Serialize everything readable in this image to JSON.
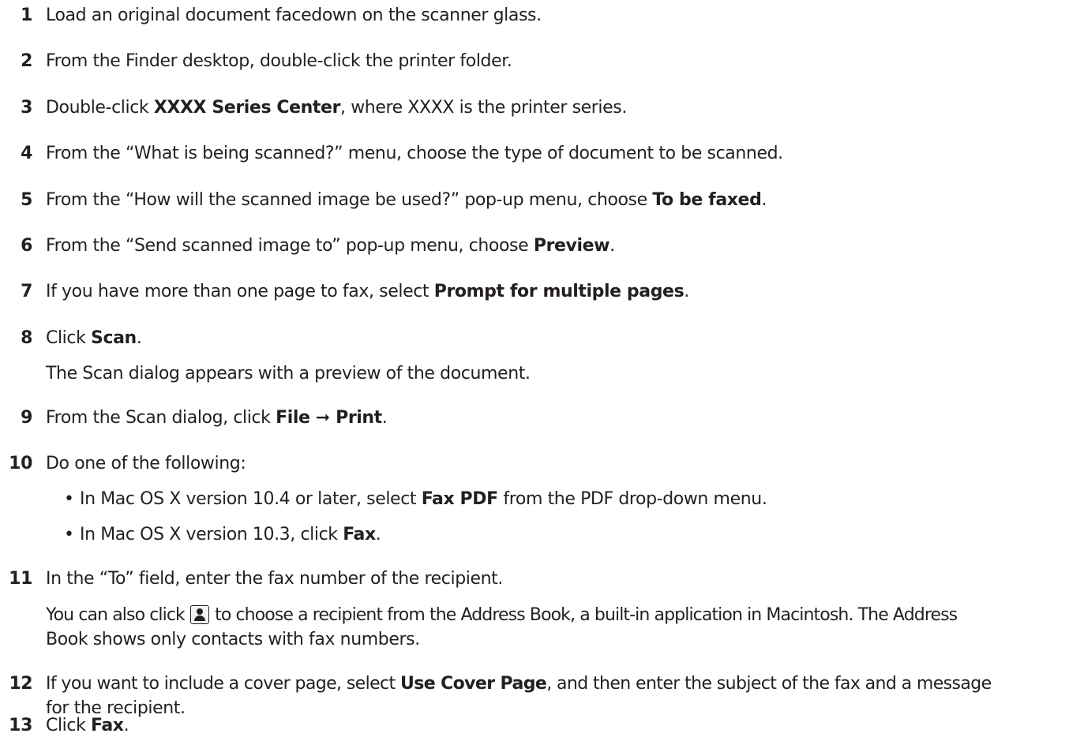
{
  "steps": [
    {
      "num": "1",
      "text": "Load an original document facedown on the scanner glass."
    },
    {
      "num": "2",
      "text": "From the Finder desktop, double-click the printer folder."
    },
    {
      "num": "3",
      "pre": "Double-click ",
      "bold": "XXXX Series Center",
      "post": ", where XXXX is the printer series."
    },
    {
      "num": "4",
      "text": "From the “What is being scanned?” menu, choose the type of document to be scanned."
    },
    {
      "num": "5",
      "pre": "From the “How will the scanned image be used?” pop-up menu, choose ",
      "bold": "To be faxed",
      "post": "."
    },
    {
      "num": "6",
      "pre": "From the “Send scanned image to” pop-up menu, choose ",
      "bold": "Preview",
      "post": "."
    },
    {
      "num": "7",
      "pre": "If you have more than one page to fax, select ",
      "bold": "Prompt for multiple pages",
      "post": "."
    },
    {
      "num": "8",
      "pre": "Click ",
      "bold": "Scan",
      "post": ".",
      "note": "The Scan dialog appears with a preview of the document."
    },
    {
      "num": "9",
      "pre": "From the Scan dialog, click ",
      "bold": "File ➞ Print",
      "post": "."
    },
    {
      "num": "10",
      "text": "Do one of the following:",
      "bullets": [
        {
          "pre": "In Mac OS X version 10.4 or later, select ",
          "bold": "Fax PDF",
          "post": " from the PDF drop-down menu."
        },
        {
          "pre": "In Mac OS X version 10.3, click ",
          "bold": "Fax",
          "post": "."
        }
      ]
    },
    {
      "num": "11",
      "text": "In the “To” field, enter the fax number of the recipient.",
      "note_pre": "You can also click ",
      "note_post": " to choose a recipient from the Address Book, a built-in application in Macintosh. The Address",
      "note_line2": "Book shows only contacts with fax numbers.",
      "note_icon": "address-book-icon"
    },
    {
      "num": "12",
      "pre": "If you want to include a cover page, select ",
      "bold": "Use Cover Page",
      "post": ", and then enter the subject of the fax and a message",
      "line2": "for the recipient."
    },
    {
      "num": "13",
      "pre": "Click ",
      "bold": "Fax",
      "post": "."
    }
  ],
  "bullet_glyph": "•"
}
